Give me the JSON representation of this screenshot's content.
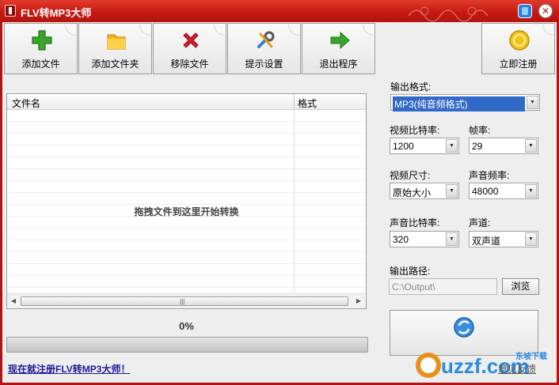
{
  "window": {
    "title": "FLV转MP3大师"
  },
  "toolbar": {
    "add_file": "添加文件",
    "add_folder": "添加文件夹",
    "remove_file": "移除文件",
    "settings": "提示设置",
    "exit": "退出程序",
    "register": "立即注册"
  },
  "file_list": {
    "col_name": "文件名",
    "col_format": "格式",
    "drop_hint": "拖拽文件到这里开始转换"
  },
  "progress": {
    "percent_text": "0%",
    "value": 0
  },
  "register_link": "现在就注册FLV转MP3大师！",
  "settings": {
    "output_format_label": "输出格式:",
    "output_format_value": "MP3(纯音频格式)",
    "video_bitrate_label": "视频比特率:",
    "video_bitrate_value": "1200",
    "framerate_label": "帧率:",
    "framerate_value": "29",
    "video_size_label": "视频尺寸:",
    "video_size_value": "原始大小",
    "audio_rate_label": "声音频率:",
    "audio_rate_value": "48000",
    "audio_bitrate_label": "声音比特率:",
    "audio_bitrate_value": "320",
    "channel_label": "声道:",
    "channel_value": "双声道",
    "output_path_label": "输出路径:",
    "output_path_value": "C:\\Output\\",
    "browse_label": "浏览"
  },
  "feedback_link": "意见反馈",
  "watermark_text": "uzzf.com",
  "watermark_sub": "东坡下载",
  "colors": {
    "titlebar": "#c41a12",
    "accent_green": "#3aa52b",
    "accent_red": "#d0202a",
    "selection": "#3169c6"
  }
}
